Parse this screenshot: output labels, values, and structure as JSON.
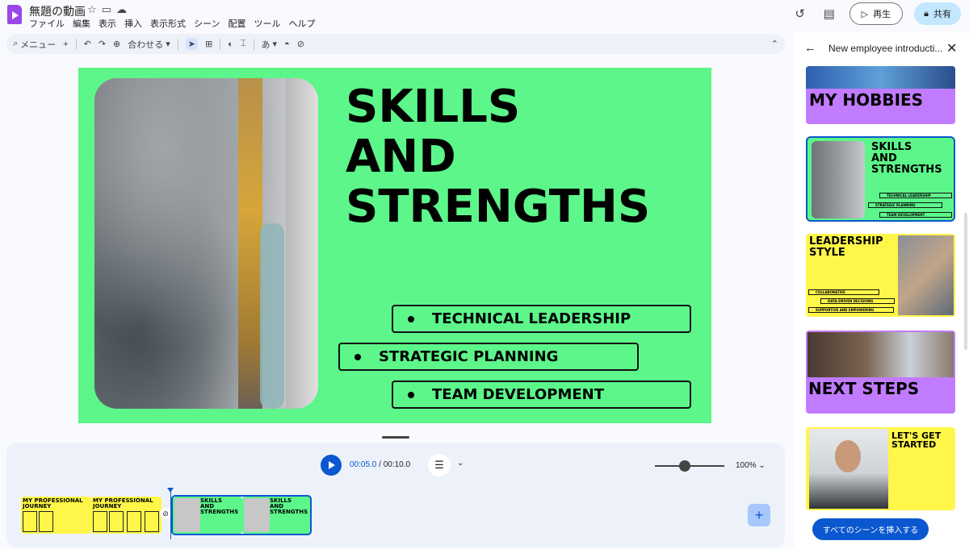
{
  "doc": {
    "title": "無題の動画"
  },
  "menu": [
    "ファイル",
    "編集",
    "表示",
    "挿入",
    "表示形式",
    "シーン",
    "配置",
    "ツール",
    "ヘルプ"
  ],
  "header": {
    "play_label": "再生",
    "share_label": "共有"
  },
  "toolbar": {
    "menu_label": "メニュー",
    "zoom_label": "合わせる",
    "text_style_label": "あ"
  },
  "slide": {
    "title": "SKILLS\nAND\nSTRENGTHS",
    "bullets": [
      "TECHNICAL LEADERSHIP",
      "STRATEGIC PLANNING",
      "TEAM DEVELOPMENT"
    ],
    "background": "#5cf68a"
  },
  "timeline": {
    "current_time": "00:05.0",
    "separator": " / ",
    "total_time": "00:10.0",
    "zoom": "100%",
    "clips": [
      {
        "title": "MY PROFESSIONAL\nJOURNEY"
      },
      {
        "title": "MY PROFESSIONAL\nJOURNEY"
      },
      {
        "title": "SKILLS\nAND\nSTRENGTHS"
      },
      {
        "title": "SKILLS\nAND\nSTRENGTHS"
      }
    ]
  },
  "panel": {
    "title": "New employee introducti...",
    "insert_all_label": "すべてのシーンを挿入する",
    "scenes": [
      {
        "title": "MY HOBBIES"
      },
      {
        "title": "SKILLS\nAND\nSTRENGTHS",
        "bullets": [
          "TECHNICAL LEADERSHIP",
          "STRATEGIC PLANNING",
          "TEAM DEVELOPMENT"
        ]
      },
      {
        "title": "LEADERSHIP\nSTYLE",
        "bullets": [
          "COLLABORATIVE",
          "DATA-DRIVEN DECISIONS",
          "SUPPORTIVE AND EMPOWERING"
        ]
      },
      {
        "title": "NEXT STEPS"
      },
      {
        "title": "LET'S GET\nSTARTED"
      }
    ]
  },
  "colors": {
    "accent": "#0b57d0",
    "green": "#5cf68a",
    "yellow": "#fef649",
    "purple": "#c17bff"
  }
}
